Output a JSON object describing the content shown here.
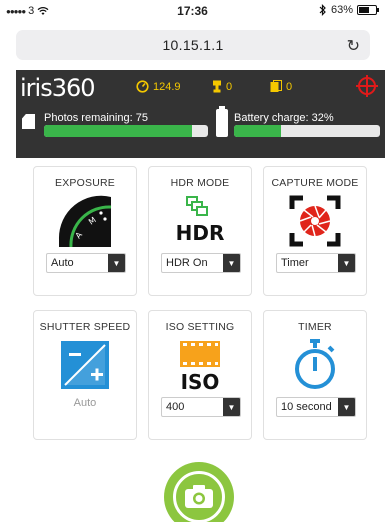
{
  "status_bar": {
    "signal": "●●●●●",
    "carrier": "3",
    "time": "17:36",
    "battery": "63%",
    "battery_level": 0.63,
    "icons": [
      "wifi-icon",
      "bluetooth-icon",
      "battery-icon"
    ]
  },
  "browser": {
    "url": "10.15.1.1",
    "reload_icon": "reload-icon"
  },
  "header": {
    "brand": "iris360",
    "stats": [
      {
        "icon": "speed-icon",
        "value": "124.9"
      },
      {
        "icon": "trophy-icon",
        "value": "0"
      },
      {
        "icon": "image-stack-icon",
        "value": "0"
      }
    ],
    "target_icon": "target-icon",
    "photos_label": "Photos remaining: 75",
    "photos_fill": 0.9,
    "battery_label": "Battery charge:  32%",
    "battery_fill": 0.32,
    "accent": "#3ab54a",
    "stat_color": "#f4c800"
  },
  "tiles": {
    "exposure": {
      "title": "EXPOSURE",
      "value": "Auto",
      "icon": "exposure-dial-icon"
    },
    "hdr": {
      "title": "HDR MODE",
      "value": "HDR On",
      "icon": "hdr-icon",
      "icon_text": "HDR"
    },
    "capture": {
      "title": "CAPTURE MODE",
      "value": "Timer",
      "icon": "aperture-icon"
    },
    "shutter": {
      "title": "SHUTTER SPEED",
      "value": "Auto",
      "icon": "exposure-compensation-icon"
    },
    "iso": {
      "title": "ISO SETTING",
      "value": "400",
      "icon": "iso-film-icon",
      "icon_text": "ISO"
    },
    "timer": {
      "title": "TIMER",
      "value": "10 second",
      "icon": "stopwatch-icon"
    }
  },
  "shutter_button": {
    "icon": "camera-icon",
    "color": "#8cc63f"
  }
}
